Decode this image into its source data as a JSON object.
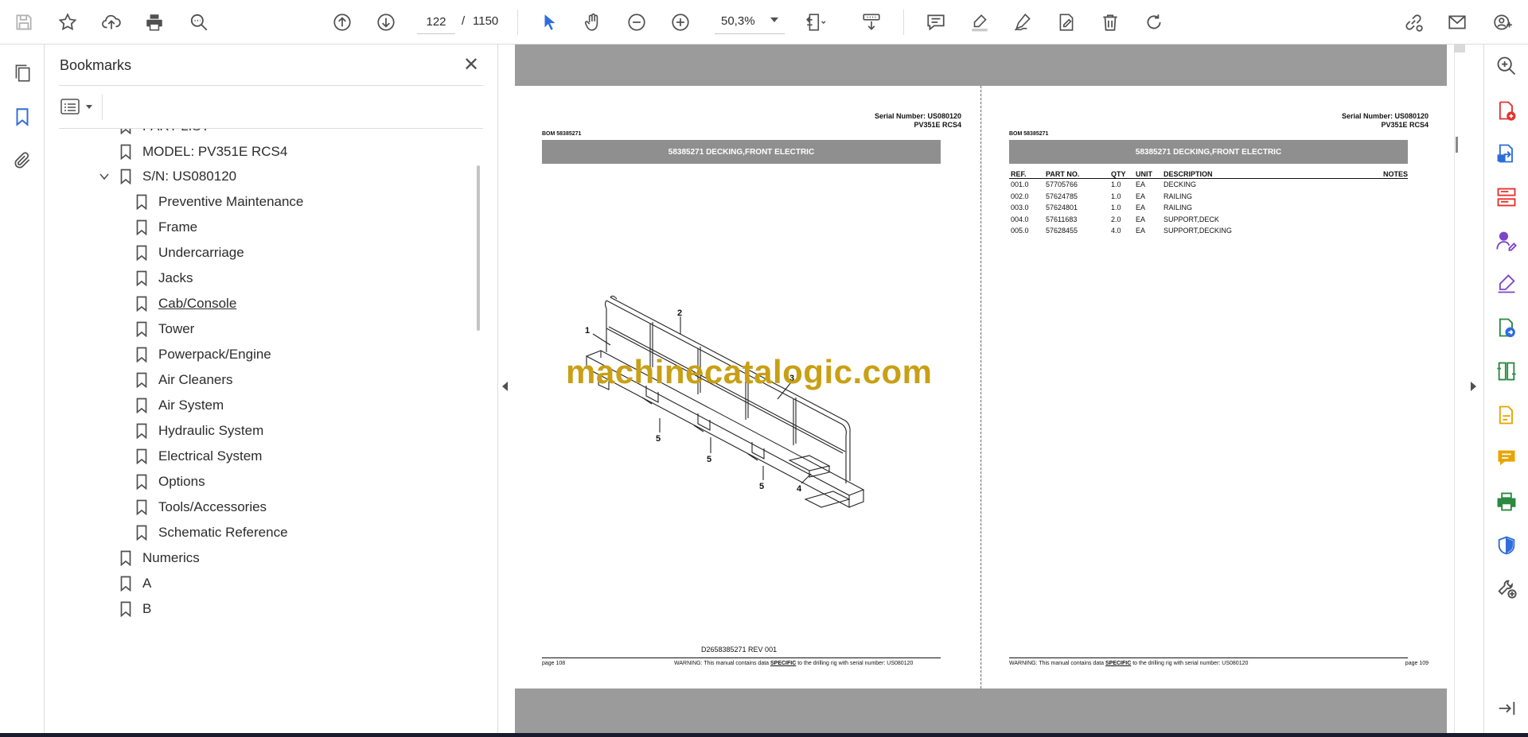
{
  "toolbar": {
    "current_page": "122",
    "page_separator": "/",
    "total_pages": "1150",
    "zoom": "50,3%",
    "icons": [
      "save-icon",
      "star-icon",
      "upload-icon",
      "print-icon",
      "search-icon",
      "page-up-icon",
      "page-down-icon",
      "select-cursor-icon",
      "hand-icon",
      "zoom-out-icon",
      "zoom-in-icon",
      "fit-page-icon",
      "scroll-mode-icon",
      "comment-icon",
      "highlight-icon",
      "draw-icon",
      "fill-sign-icon",
      "delete-icon",
      "rotate-icon",
      "share-link-icon",
      "email-icon",
      "account-icon"
    ]
  },
  "left_rail": {
    "icons": [
      "pages-icon",
      "bookmark-icon",
      "attachment-icon"
    ]
  },
  "bookmarks": {
    "title": "Bookmarks",
    "items": [
      {
        "label": "PART LIST",
        "level": 1
      },
      {
        "label": "MODEL: PV351E RCS4",
        "level": 1
      },
      {
        "label": "S/N: US080120",
        "level": 1,
        "expanded": true
      },
      {
        "label": "Preventive Maintenance",
        "level": 2
      },
      {
        "label": "Frame",
        "level": 2
      },
      {
        "label": "Undercarriage",
        "level": 2
      },
      {
        "label": "Jacks",
        "level": 2
      },
      {
        "label": "Cab/Console",
        "level": 2,
        "hovered": true
      },
      {
        "label": "Tower",
        "level": 2
      },
      {
        "label": "Powerpack/Engine",
        "level": 2
      },
      {
        "label": "Air Cleaners",
        "level": 2
      },
      {
        "label": "Air System",
        "level": 2
      },
      {
        "label": "Hydraulic System",
        "level": 2
      },
      {
        "label": "Electrical System",
        "level": 2
      },
      {
        "label": "Options",
        "level": 2
      },
      {
        "label": "Tools/Accessories",
        "level": 2
      },
      {
        "label": "Schematic Reference",
        "level": 2
      },
      {
        "label": "Numerics",
        "level": 1
      },
      {
        "label": "A",
        "level": 1
      },
      {
        "label": "B",
        "level": 1
      }
    ]
  },
  "document": {
    "left_page": {
      "serial_line": "Serial Number: US080120",
      "model_line": "PV351E RCS4",
      "bom": "BOM 58385271",
      "title": "58385271 DECKING,FRONT ELECTRIC",
      "drawing_callouts": [
        "1",
        "2",
        "3",
        "4",
        "5",
        "5",
        "5"
      ],
      "drawing_id": "D2658385271 REV 001",
      "page_label": "page 108",
      "warning_prefix": "WARNING:  This manual contains data ",
      "warning_emph": "SPECIFIC",
      "warning_suffix": " to the drilling rig with serial number: US080120"
    },
    "right_page": {
      "serial_line": "Serial Number: US080120",
      "model_line": "PV351E RCS4",
      "bom": "BOM 58385271",
      "title": "58385271 DECKING,FRONT ELECTRIC",
      "table_headers": {
        "ref": "REF.",
        "part": "PART NO.",
        "qty": "QTY",
        "unit": "UNIT",
        "desc": "DESCRIPTION",
        "notes": "NOTES"
      },
      "rows": [
        {
          "ref": "001.0",
          "part": "57705766",
          "qty": "1.0",
          "unit": "EA",
          "desc": "DECKING"
        },
        {
          "ref": "002.0",
          "part": "57624785",
          "qty": "1.0",
          "unit": "EA",
          "desc": "RAILING"
        },
        {
          "ref": "003.0",
          "part": "57624801",
          "qty": "1.0",
          "unit": "EA",
          "desc": "RAILING"
        },
        {
          "ref": "004.0",
          "part": "57611683",
          "qty": "2.0",
          "unit": "EA",
          "desc": "SUPPORT,DECK"
        },
        {
          "ref": "005.0",
          "part": "57628455",
          "qty": "4.0",
          "unit": "EA",
          "desc": "SUPPORT,DECKING"
        }
      ],
      "page_label": "page 109",
      "warning_prefix": "WARNING:  This manual contains data ",
      "warning_emph": "SPECIFIC",
      "warning_suffix": " to the drilling rig with serial number: US080120"
    },
    "watermark": "machinecatalogic.com"
  },
  "right_rail": {
    "icons": [
      "zoom-search-icon",
      "create-pdf-icon",
      "export-pdf-icon",
      "organize-pages-icon",
      "request-signature-icon",
      "fill-and-sign-icon",
      "convert-pdf-icon",
      "compare-icon",
      "edit-pdf-icon",
      "comment-panel-icon",
      "print-production-icon",
      "protect-icon",
      "more-tools-icon",
      "expand-panel-icon"
    ],
    "colors": {
      "red": "#e5322d",
      "blue": "#2e6ddb",
      "purple": "#7e44c6",
      "yellow": "#e8a400",
      "green": "#2a8a3f"
    }
  }
}
